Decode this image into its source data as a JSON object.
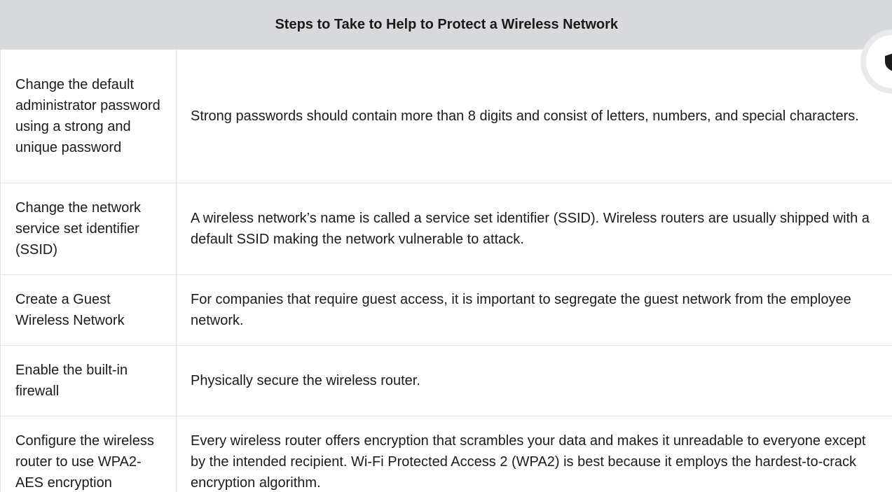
{
  "table": {
    "title": "Steps to Take to Help to Protect a Wireless Network",
    "rows": [
      {
        "step": "Change the default administrator password using a strong and unique password",
        "description": "Strong passwords should contain more than 8 digits and consist of letters, numbers, and special characters."
      },
      {
        "step": "Change the network service set identifier (SSID)",
        "description": "A wireless network’s name is called a service set identifier (SSID). Wireless routers are usually shipped with a default SSID making the network vulnerable to attack."
      },
      {
        "step": "Create a Guest Wireless Network",
        "description": "For companies that require guest access, it is important to segregate the guest network from the employee network."
      },
      {
        "step": "Enable the built-in firewall",
        "description": "Physically secure the wireless router."
      },
      {
        "step": "Configure the wireless router to use WPA2-AES encryption",
        "description": "Every wireless router offers encryption that scrambles your data and makes it unreadable to everyone except by the intended recipient. Wi-Fi Protected Access 2 (WPA2) is best because it employs the hardest-to-crack encryption algorithm."
      }
    ]
  },
  "floating_button": {
    "icon": "shield-icon"
  },
  "colors": {
    "header_bg": "#d8d9dc",
    "border": "#e2e3e6",
    "text": "#1b1b1b"
  }
}
